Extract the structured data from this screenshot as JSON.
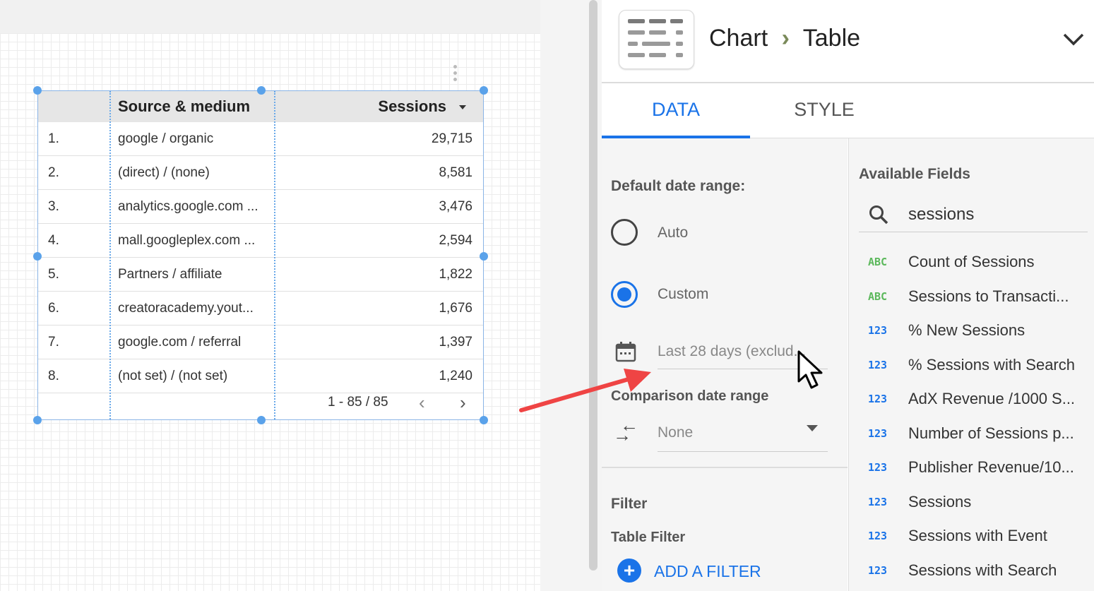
{
  "table": {
    "headers": {
      "dimension": "Source & medium",
      "metric": "Sessions",
      "sort_icon": "sort-desc-arrow"
    },
    "rows": [
      {
        "num": "1.",
        "source": "google / organic",
        "sessions": "29,715"
      },
      {
        "num": "2.",
        "source": "(direct) / (none)",
        "sessions": "8,581"
      },
      {
        "num": "3.",
        "source": "analytics.google.com ...",
        "sessions": "3,476"
      },
      {
        "num": "4.",
        "source": "mall.googleplex.com ...",
        "sessions": "2,594"
      },
      {
        "num": "5.",
        "source": "Partners / affiliate",
        "sessions": "1,822"
      },
      {
        "num": "6.",
        "source": "creatoracademy.yout...",
        "sessions": "1,676"
      },
      {
        "num": "7.",
        "source": "google.com / referral",
        "sessions": "1,397"
      },
      {
        "num": "8.",
        "source": "(not set) / (not set)",
        "sessions": "1,240"
      }
    ],
    "pagination": "1 - 85 / 85"
  },
  "header": {
    "crumb_parent": "Chart",
    "crumb_child": "Table"
  },
  "tabs": [
    {
      "label": "DATA",
      "active": true
    },
    {
      "label": "STYLE",
      "active": false
    }
  ],
  "data_tab": {
    "default_date_label": "Default date range:",
    "auto_label": "Auto",
    "custom_label": "Custom",
    "custom_selected": true,
    "date_value": "Last 28 days (exclud...",
    "comparison_label": "Comparison date range",
    "comparison_value": "None",
    "filter_heading": "Filter",
    "table_filter_label": "Table Filter",
    "add_filter_label": "ADD A FILTER"
  },
  "fields": {
    "heading": "Available Fields",
    "search_value": "sessions",
    "items": [
      {
        "type": "ABC",
        "name": "Count of Sessions"
      },
      {
        "type": "ABC",
        "name": "Sessions to Transacti..."
      },
      {
        "type": "123",
        "name": "% New Sessions"
      },
      {
        "type": "123",
        "name": "% Sessions with Search"
      },
      {
        "type": "123",
        "name": "AdX Revenue /1000 S..."
      },
      {
        "type": "123",
        "name": "Number of Sessions p..."
      },
      {
        "type": "123",
        "name": "Publisher Revenue/10..."
      },
      {
        "type": "123",
        "name": "Sessions"
      },
      {
        "type": "123",
        "name": "Sessions with Event"
      },
      {
        "type": "123",
        "name": "Sessions with Search"
      }
    ]
  },
  "colors": {
    "accent": "#1a73e8",
    "dimension_type": "#5cb85c",
    "metric_type": "#1a73e8",
    "arrow": "#ef4444"
  }
}
